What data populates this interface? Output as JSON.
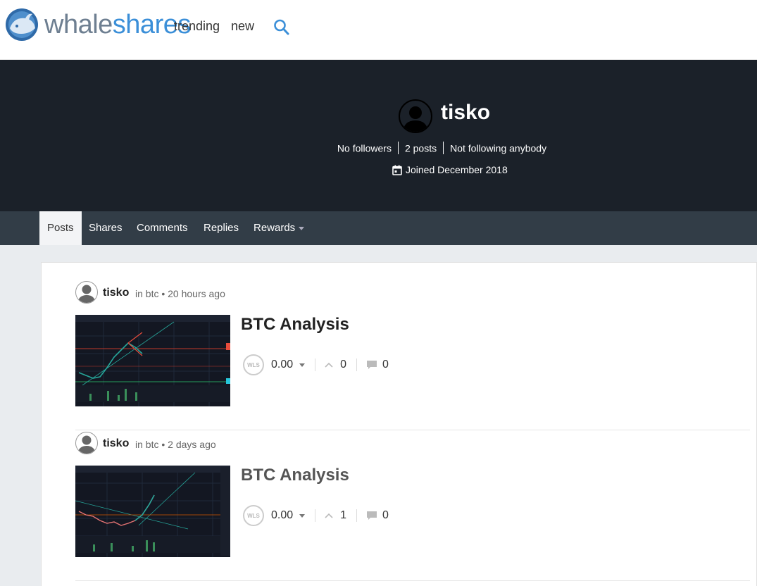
{
  "header": {
    "brand_part1": "whale",
    "brand_part2": "shares",
    "nav": {
      "trending": "trending",
      "new": "new"
    }
  },
  "profile": {
    "username": "tisko",
    "followers": "No followers",
    "posts": "2 posts",
    "following": "Not following anybody",
    "joined": "Joined December 2018"
  },
  "tabs": [
    "Posts",
    "Shares",
    "Comments",
    "Replies",
    "Rewards"
  ],
  "posts": [
    {
      "author": "tisko",
      "meta": "in btc • 20 hours ago",
      "title": "BTC Analysis",
      "payout": "0.00",
      "votes": "0",
      "comments": "0"
    },
    {
      "author": "tisko",
      "meta": "in btc • 2 days ago",
      "title": "BTC Analysis",
      "payout": "0.00",
      "votes": "1",
      "comments": "0"
    }
  ],
  "colors": {
    "hero_bg": "#1b2129",
    "tabbar_bg": "#323d47",
    "brand_blue": "#3b8fd8",
    "brand_gray": "#6e7f91"
  },
  "icons": {
    "search": "search-icon",
    "calendar": "calendar-icon",
    "wls": "wls-token-icon",
    "upvote": "upvote-icon",
    "comment": "comment-icon"
  }
}
